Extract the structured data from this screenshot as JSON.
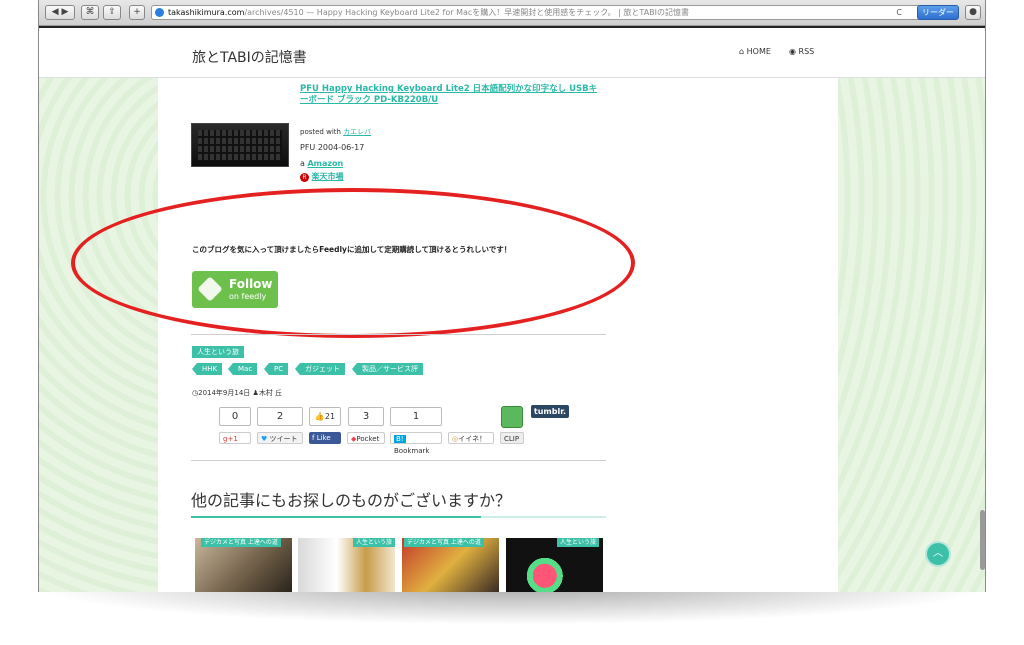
{
  "browser": {
    "url_domain": "takashikimura.com",
    "url_rest": "/archives/4510 — Happy Hacking Keyboard Lite2 for Macを購入！早速開封と使用感をチェック。 | 旅とTABIの記憶書",
    "reader_label": "リーダー",
    "back_label": "◀",
    "forward_label": "▶",
    "plus_label": "+",
    "reload_label": "C"
  },
  "header": {
    "site_title": "旅とTABIの記憶書",
    "nav_home": "HOME",
    "nav_rss": "RSS"
  },
  "product": {
    "title": "PFU Happy Hacking Keyboard Lite2 日本語配列かな印字なし USBキーボード ブラック PD-KB220B/U",
    "posted_with_prefix": "posted with",
    "posted_with_link": "カエレバ",
    "maker_date": "PFU 2004-06-17",
    "amazon_label": "Amazon",
    "rakuten_label": "楽天市場"
  },
  "feedly": {
    "message": "このブログを気に入って頂けましたらFeedlyに追加して定期購読して頂けるとうれしいです！",
    "follow_label": "Follow",
    "on_label": "on feedly"
  },
  "tags": {
    "category": "人生という旅",
    "items": [
      "HHK",
      "Mac",
      "PC",
      "ガジェット",
      "製品／サービス評"
    ]
  },
  "meta": {
    "date": "2014年9月14日",
    "author": "木村 丘"
  },
  "share": {
    "counts": [
      "0",
      "2",
      "21",
      "3",
      "1"
    ],
    "gplus": "+1",
    "tweet": "ツイート",
    "like": "Like",
    "pocket": "Pocket",
    "bookmark": "Bookmark",
    "iine": "イイネ！",
    "clip": "CLIP",
    "tumblr": "tumblr."
  },
  "related": {
    "title": "他の記事にもお探しのものがございますか？",
    "items": [
      {
        "label": "デジカメと写真 上達への道"
      },
      {
        "label": "人生という旅"
      },
      {
        "label": "デジカメと写真 上達への道"
      },
      {
        "label": "人生という旅"
      }
    ]
  },
  "colors": {
    "accent": "#3cc0a8",
    "feedly_green": "#6ec04d",
    "annotation_red": "#e52020"
  }
}
